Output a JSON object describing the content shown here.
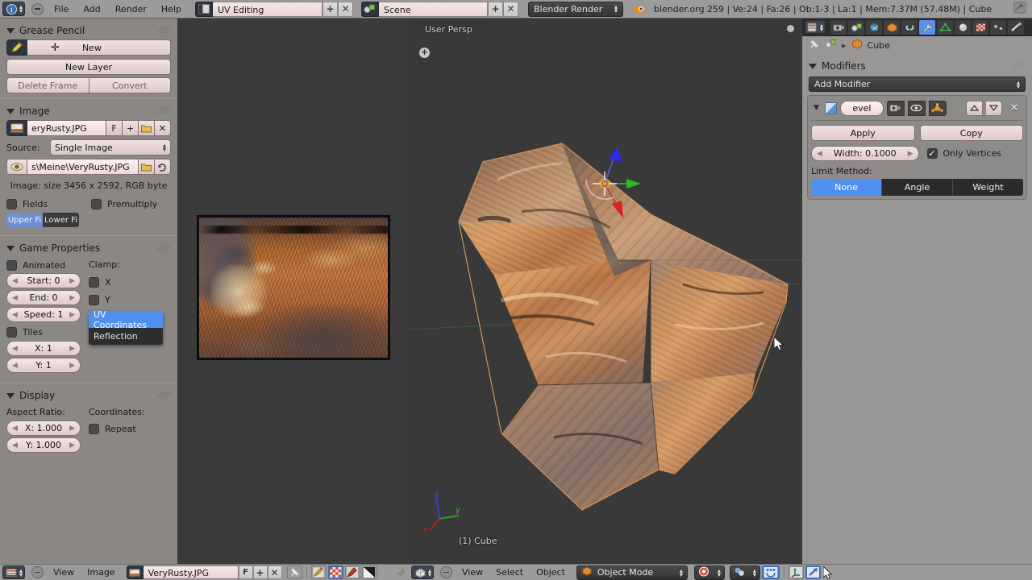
{
  "topbar": {
    "editor_icon": "editor-type-icon",
    "collapse_icon": "collapse-menu-icon",
    "menus": [
      "File",
      "Add",
      "Render",
      "Help"
    ],
    "screen_layout": {
      "icon": "screen-layout-icon",
      "value": "UV Editing",
      "add_label": "+",
      "delete_label": "✕"
    },
    "scene": {
      "icon": "scene-icon",
      "value": "Scene",
      "add_label": "+",
      "delete_label": "✕"
    },
    "render_engine": "Blender Render",
    "status": "blender.org 259 | Ve:24 | Fa:26 | Ob:1-3 | La:1 | Mem:7.37M (57.48M) | Cube",
    "corner_icon": "resize-corner-icon"
  },
  "left_panel": {
    "grease_pencil": {
      "title": "Grease Pencil",
      "new_label": "New",
      "new_layer_label": "New Layer",
      "delete_frame_label": "Delete Frame",
      "convert_label": "Convert"
    },
    "image": {
      "title": "Image",
      "datablock_name": "eryRusty.JPG",
      "fake_user_label": "F",
      "add_label": "+",
      "open_label": "open-folder-icon",
      "unlink_label": "✕",
      "source_label": "Source:",
      "source_value": "Single Image",
      "filepath": "s\\Meine\\VeryRusty.JPG",
      "filepath_browse": "folder-icon",
      "filepath_reload": "reload-icon",
      "info": "Image: size 3456 x 2592, RGB byte",
      "fields_label": "Fields",
      "fields_checked": false,
      "premultiply_label": "Premultiply",
      "premultiply_checked": false,
      "field_order": [
        "Upper Fi",
        "Lower Fi"
      ],
      "field_order_selected": "Upper Fi"
    },
    "game_properties": {
      "title": "Game Properties",
      "animated_label": "Animated",
      "animated_checked": false,
      "start_label": "Start: 0",
      "end_label": "End: 0",
      "speed_label": "Speed: 1",
      "tiles_label": "Tiles",
      "tiles_checked": false,
      "x_label": "X: 1",
      "y_label": "Y: 1",
      "clamp_label": "Clamp:",
      "clamp_x_label": "X",
      "clamp_x_checked": false,
      "clamp_y_label": "Y",
      "clamp_y_checked": false,
      "mapping_options": [
        "UV Coordinates",
        "Reflection"
      ],
      "mapping_selected": "UV Coordinates"
    },
    "display": {
      "title": "Display",
      "aspect_ratio_label": "Aspect Ratio:",
      "aspect_x": "X: 1.000",
      "aspect_y": "Y: 1.000",
      "coordinates_label": "Coordinates:",
      "repeat_label": "Repeat",
      "repeat_checked": false
    }
  },
  "viewport": {
    "view_name": "User Persp",
    "object_info": "(1) Cube",
    "add_overlay_icon": "add-object-icon",
    "mini_axis_icon": "mini-axis-gizmo",
    "cursor_icon": "mouse-cursor"
  },
  "right_panel": {
    "tabs": [
      "render-tab-icon",
      "scene-tab-icon",
      "world-tab-icon",
      "object-tab-icon",
      "constraints-tab-icon",
      "modifiers-tab-icon",
      "data-tab-icon",
      "material-tab-icon",
      "texture-tab-icon",
      "particles-tab-icon",
      "physics-tab-icon"
    ],
    "active_tab": "modifiers-tab-icon",
    "breadcrumb": {
      "pin_icon": "pin-icon",
      "object_icon": "object-icon",
      "separator": "▸",
      "cube_icon": "cube-icon",
      "object_name": "Cube"
    },
    "modifiers_title": "Modifiers",
    "add_modifier_label": "Add Modifier",
    "modifier": {
      "expand_icon": "collapse-triangle-icon",
      "type_icon": "bevel-modifier-icon",
      "name": "evel",
      "render_toggle_icon": "render-visibility-icon",
      "viewport_toggle_icon": "eye-visibility-icon",
      "edit_toggle_icon": "edit-mode-visibility-icon",
      "move_up_icon": "move-up-icon",
      "move_down_icon": "move-down-icon",
      "delete_icon": "delete-modifier-icon",
      "apply_label": "Apply",
      "copy_label": "Copy",
      "width_label": "Width: 0.1000",
      "only_vertices_label": "Only Vertices",
      "only_vertices_checked": true,
      "limit_method_label": "Limit Method:",
      "limit_options": [
        "None",
        "Angle",
        "Weight"
      ],
      "limit_selected": "None"
    }
  },
  "bottom_image_header": {
    "editor_icon": "image-editor-icon",
    "collapse_icon": "collapse-menu-icon",
    "menus": [
      "View",
      "Image"
    ],
    "datablock_icon": "image-datablock-icon",
    "datablock_name": "VeryRusty.JPG",
    "fake_user_label": "F",
    "add_label": "+",
    "unlink_label": "✕",
    "pin_icon": "pin-icon",
    "mode_icons": [
      "paint-icon",
      "uv-face-select-icon",
      "texture-paint-icon",
      "alpha-icon"
    ]
  },
  "bottom_view_header": {
    "editor_icon": "view3d-editor-icon",
    "collapse_icon": "collapse-menu-icon",
    "menus": [
      "View",
      "Select",
      "Object"
    ],
    "mode_icon": "object-mode-icon",
    "mode_value": "Object Mode",
    "shading_icon": "textured-shading-icon",
    "pivot_icon": "pivot-point-icon",
    "snap_icon": "snap-magnet-icon",
    "manipulator_icon": "manipulator-icon",
    "translate_icon": "translate-manipulator-icon",
    "cursor_icon": "mouse-cursor"
  },
  "colors": {
    "accent_blue": "#4e8ff0",
    "panel_gray": "#8a8785",
    "header_gray": "#9b9b9b",
    "viewport_bg": "#393939",
    "rust_orange": "#c07a3f"
  }
}
